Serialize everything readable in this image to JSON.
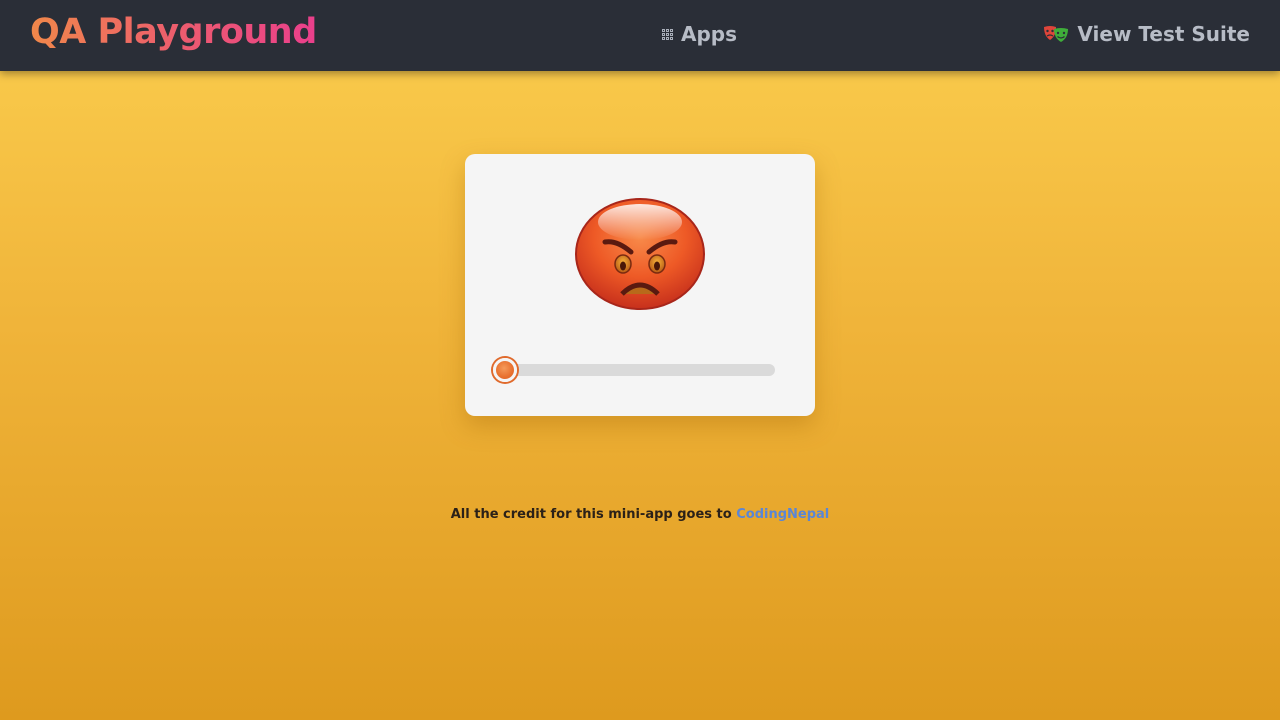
{
  "navbar": {
    "brand": "QA Playground",
    "apps_label": "Apps",
    "apps_icon": "grid-icon",
    "suite_label": "View Test Suite",
    "suite_icon": "theater-masks-icon"
  },
  "card": {
    "emoji_icon": "angry-face-icon",
    "slider_value": 0
  },
  "footer": {
    "credit_text": "All the credit for this mini-app goes to ",
    "credit_link": "CodingNepal"
  },
  "colors": {
    "navbar_bg": "#2a2e37",
    "brand_gradient_start": "#f0884a",
    "brand_gradient_end": "#ea3f8c",
    "page_bg_top": "#fbce4e",
    "page_bg_bottom": "#de9a1e",
    "slider_thumb": "#e8702e",
    "link": "#5a86d6"
  }
}
